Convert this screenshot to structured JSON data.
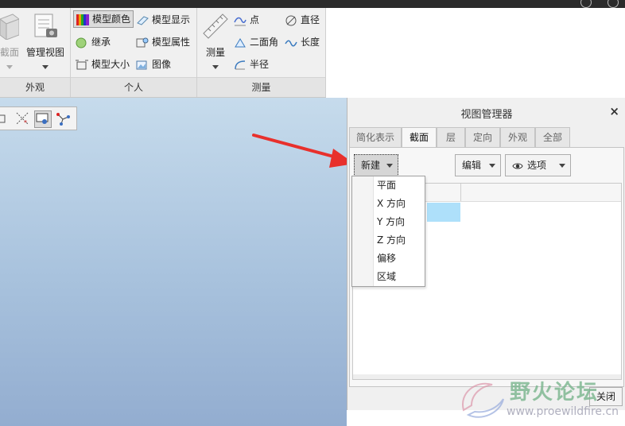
{
  "ribbon": {
    "groups": {
      "appearance": {
        "label": "外观",
        "partial_label": "截面",
        "manage_view": "管理视图"
      },
      "personal": {
        "label": "个人",
        "model_color": "模型颜色",
        "model_display": "模型显示",
        "inherit": "继承",
        "model_properties": "模型属性",
        "model_size": "模型大小",
        "image": "图像"
      },
      "measure": {
        "label": "测量",
        "measure_button": "测量",
        "point": "点",
        "diameter": "直径",
        "dihedral_angle": "二面角",
        "length": "长度",
        "radius": "半径"
      }
    }
  },
  "view_manager": {
    "title": "视图管理器",
    "close_x": "×",
    "tabs": [
      {
        "label": "简化表示"
      },
      {
        "label": "截面",
        "active": true
      },
      {
        "label": "层"
      },
      {
        "label": "定向"
      },
      {
        "label": "外观"
      },
      {
        "label": "全部"
      }
    ],
    "new_button": "新建",
    "edit_button": "编辑",
    "options_button": "选项",
    "close_button": "关闭"
  },
  "new_menu": {
    "items": [
      "平面",
      "X 方向",
      "Y 方向",
      "Z 方向",
      "偏移",
      "区域"
    ]
  },
  "watermark": {
    "site_name": "野火论坛",
    "url": "www.proewildfire.cn"
  },
  "colors": {
    "arrow": "#e8302c",
    "selection": "#aee0fa",
    "viewport_top": "#c6dbec",
    "viewport_bottom": "#93add0"
  }
}
